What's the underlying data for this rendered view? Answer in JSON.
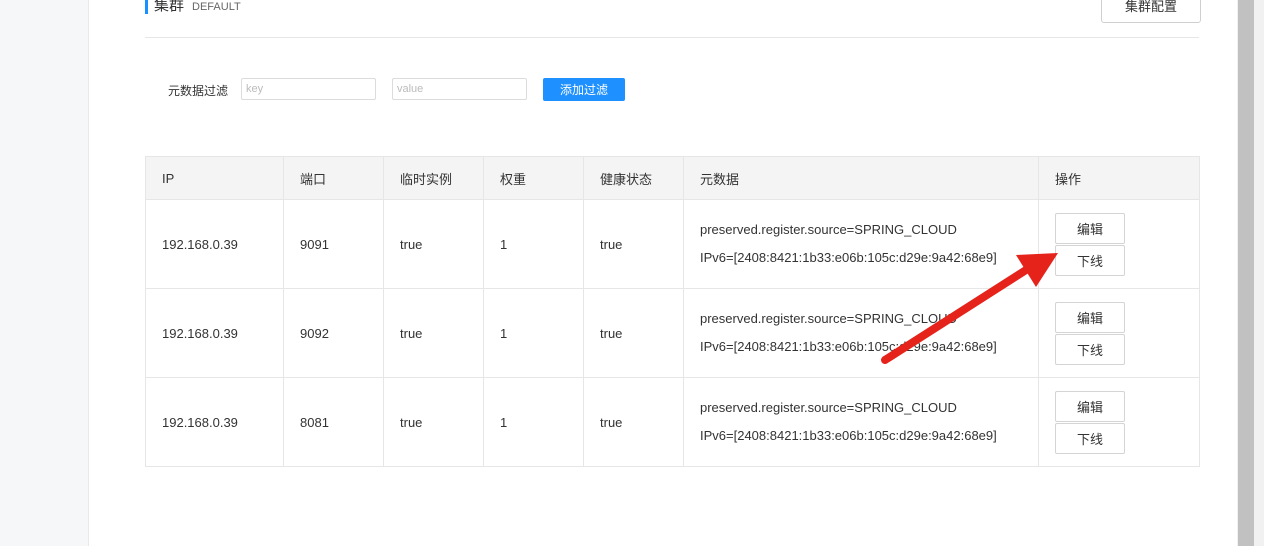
{
  "cluster": {
    "title": "集群",
    "name": "DEFAULT",
    "config_button": "集群配置"
  },
  "filter": {
    "label": "元数据过滤",
    "key_placeholder": "key",
    "value_placeholder": "value",
    "add_button": "添加过滤"
  },
  "table": {
    "headers": [
      "IP",
      "端口",
      "临时实例",
      "权重",
      "健康状态",
      "元数据",
      "操作"
    ],
    "rows": [
      {
        "ip": "192.168.0.39",
        "port": "9091",
        "ephemeral": "true",
        "weight": "1",
        "healthy": "true",
        "metadata": [
          "preserved.register.source=SPRING_CLOUD",
          "IPv6=[2408:8421:1b33:e06b:105c:d29e:9a42:68e9]"
        ],
        "edit": "编辑",
        "offline": "下线"
      },
      {
        "ip": "192.168.0.39",
        "port": "9092",
        "ephemeral": "true",
        "weight": "1",
        "healthy": "true",
        "metadata": [
          "preserved.register.source=SPRING_CLOUD",
          "IPv6=[2408:8421:1b33:e06b:105c:d29e:9a42:68e9]"
        ],
        "edit": "编辑",
        "offline": "下线"
      },
      {
        "ip": "192.168.0.39",
        "port": "8081",
        "ephemeral": "true",
        "weight": "1",
        "healthy": "true",
        "metadata": [
          "preserved.register.source=SPRING_CLOUD",
          "IPv6=[2408:8421:1b33:e06b:105c:d29e:9a42:68e9]"
        ],
        "edit": "编辑",
        "offline": "下线"
      }
    ]
  },
  "annotation": {
    "color": "#e5231b",
    "icon": "red-arrow"
  }
}
